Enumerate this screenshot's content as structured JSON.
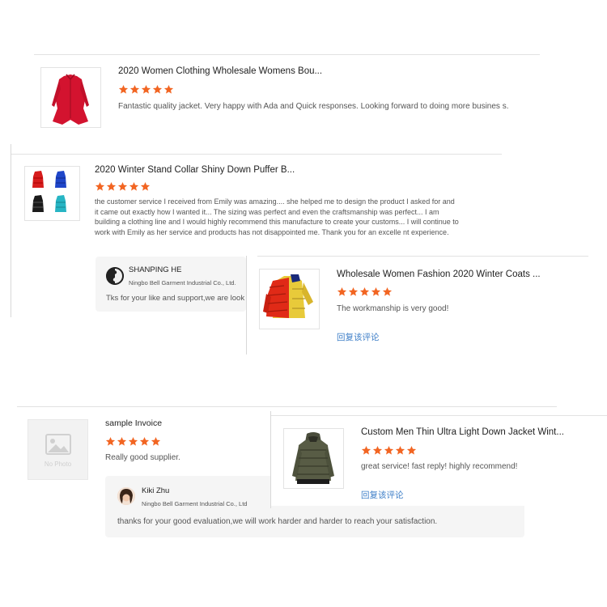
{
  "colors": {
    "star": "#f26522",
    "link": "#3f7fc8"
  },
  "reviews": [
    {
      "title": "2020 Women Clothing Wholesale Womens Bou...",
      "rating": 5,
      "text": "Fantastic quality jacket. Very happy with Ada and Quick responses. Looking forward to doing more busines s.",
      "image_icon": "red-peplum-jacket-image"
    },
    {
      "title": "2020 Winter Stand Collar Shiny Down Puffer B...",
      "rating": 5,
      "text": "the customer service I received from Emily was amazing.... she helped me to design the product I asked for and it came out exactly how I wanted it... The sizing was perfect and even the craftsmanship was perfect... I am building a clothing line and I would highly recommend this manufacture to create your customs... I will continue to work with Emily as her service and products has not disappointed me. Thank you for an excelle nt experience.",
      "image_icon": "puffer-jackets-grid-image",
      "reply": {
        "name": "SHANPING HE",
        "company": "Ningbo Bell Garment Industrial Co., Ltd.",
        "text": "Tks for your like and support,we are look"
      }
    },
    {
      "title": "Wholesale Women Fashion 2020 Winter Coats ...",
      "rating": 5,
      "text": "The workmanship is very good!",
      "image_icon": "color-block-puffer-image",
      "link": "回复该评论"
    },
    {
      "title": "sample Invoice",
      "rating": 5,
      "text": "Really good supplier.",
      "image_icon": "no-photo-placeholder",
      "placeholder_text": "No Photo",
      "reply": {
        "name": "Kiki Zhu",
        "company": "Ningbo Bell Garment Industrial Co., Ltd",
        "text": "thanks for your  good evaluation,we will work harder and harder to reach your satisfaction."
      }
    },
    {
      "title": "Custom Men Thin Ultra Light Down Jacket Wint...",
      "rating": 5,
      "text": "great service! fast reply! highly recommend!",
      "image_icon": "olive-hooded-down-jacket-image",
      "link": "回复该评论"
    }
  ]
}
